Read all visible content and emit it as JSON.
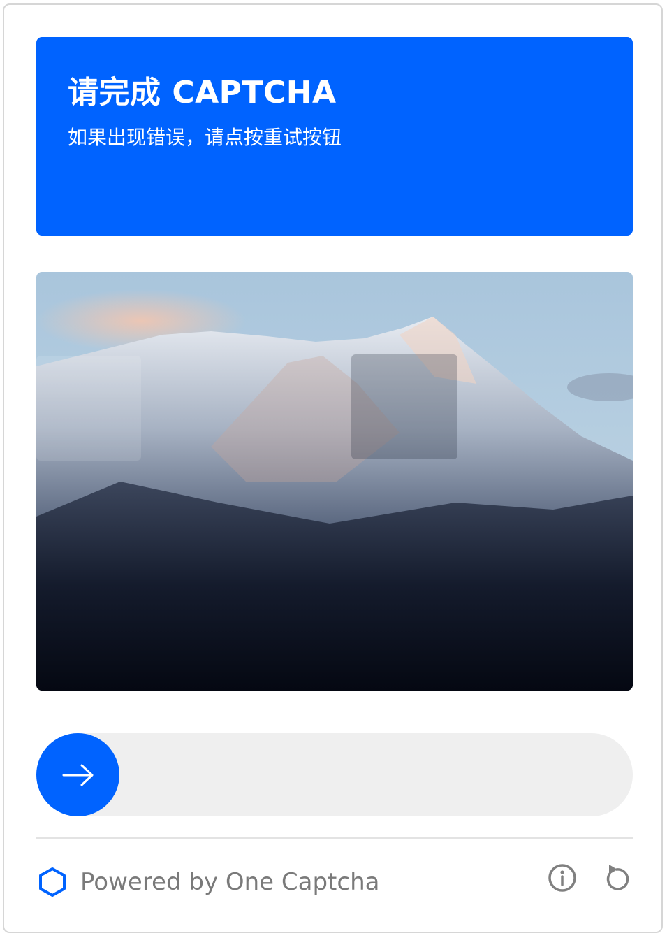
{
  "header": {
    "title": "请完成 CAPTCHA",
    "subtitle": "如果出现错误，请点按重试按钮"
  },
  "puzzle": {
    "image_description_icon": "mountain-image",
    "piece_icon": "puzzle-piece",
    "slot_icon": "puzzle-slot"
  },
  "slider": {
    "progress": 0,
    "handle_icon": "arrow-right-icon"
  },
  "footer": {
    "brand_icon": "hexagon-icon",
    "brand_text": "Powered by One Captcha",
    "info_icon": "info-icon",
    "refresh_icon": "refresh-icon"
  },
  "colors": {
    "accent": "#0063ff",
    "track": "#efefef",
    "footer_text": "#7a7a7a",
    "icon_gray": "#808080"
  }
}
